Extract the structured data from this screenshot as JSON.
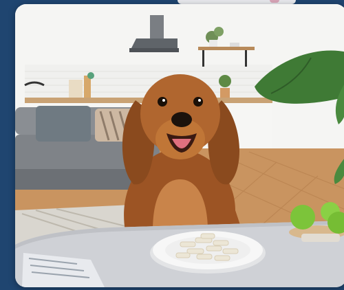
{
  "image": {
    "subject": "dog-looking-at-treats",
    "colors": {
      "frame_background": "#1f4570",
      "card_background": "#f1f2f4",
      "dog_fur": "#a55a28",
      "table": "#cfd1d6",
      "plate": "#f7f7f7",
      "apples": "#7cc43a",
      "plant": "#3f7a35",
      "sofa": "#7f8388",
      "floor": "#c99460"
    }
  }
}
